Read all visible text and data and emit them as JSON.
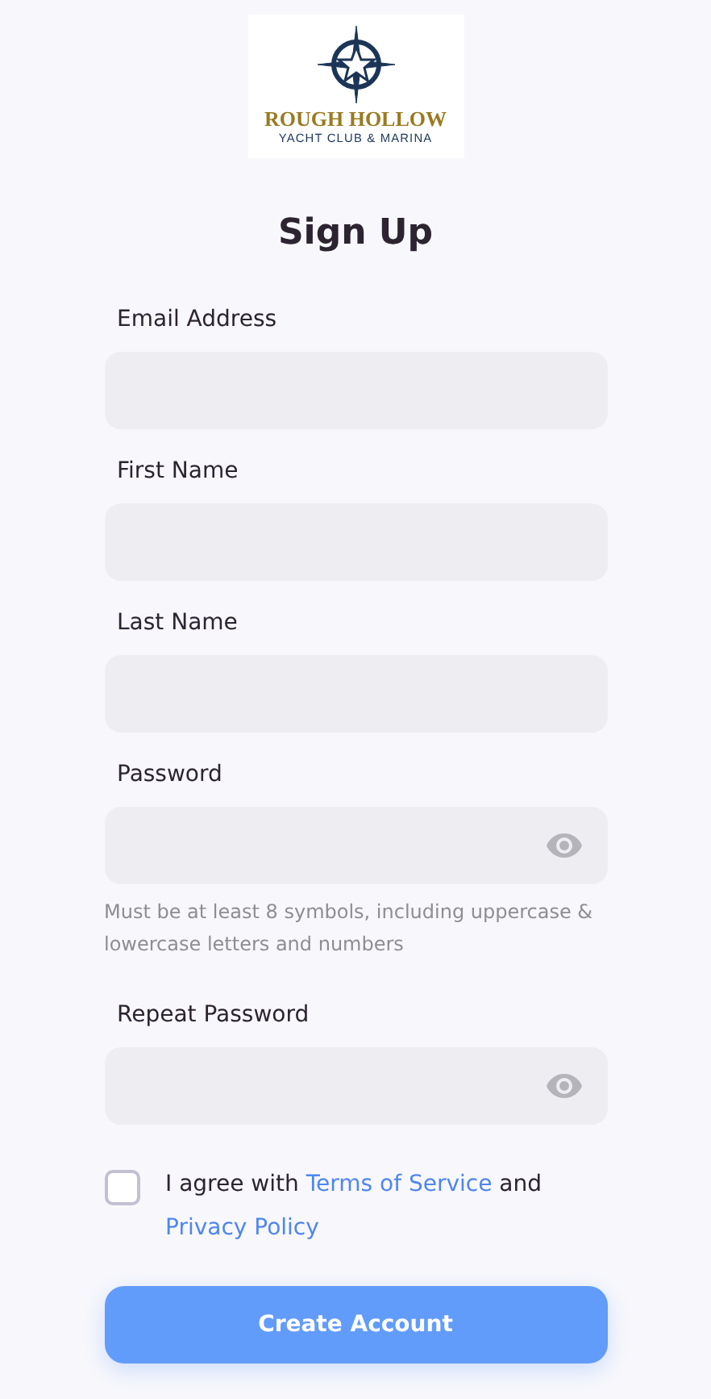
{
  "logo": {
    "name": "ROUGH HOLLOW",
    "tagline": "YACHT CLUB & MARINA"
  },
  "title": "Sign Up",
  "fields": [
    {
      "label": "Email Address",
      "kind": "text"
    },
    {
      "label": "First Name",
      "kind": "text"
    },
    {
      "label": "Last Name",
      "kind": "text"
    },
    {
      "label": "Password",
      "kind": "password",
      "hint": "Must be at least 8 symbols, including uppercase & lowercase letters and numbers"
    },
    {
      "label": "Repeat Password",
      "kind": "password"
    }
  ],
  "agreement": {
    "checked": false,
    "text_before": "I agree with",
    "terms_link": "Terms of Service",
    "text_middle": "and",
    "privacy_link": "Privacy Policy"
  },
  "submit_button": "Create Account"
}
